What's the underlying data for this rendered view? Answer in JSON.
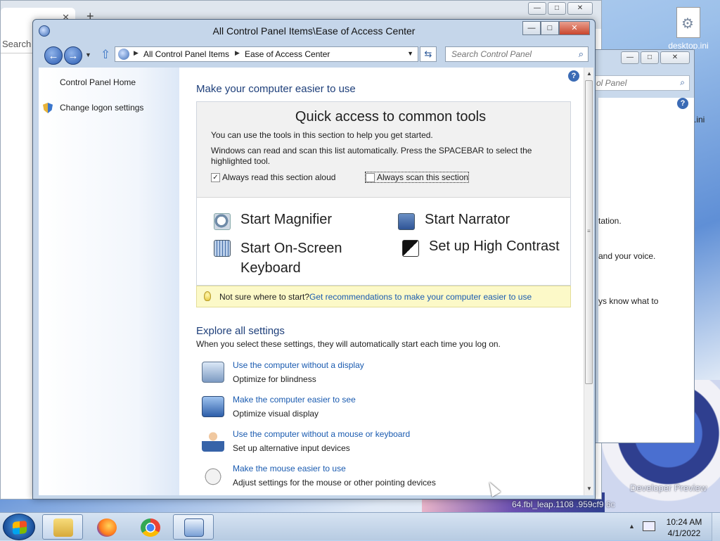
{
  "desktop": {
    "icon_label": "desktop.ini",
    "watermark_line1": "Developer Preview",
    "watermark_line2": "64.fbl_leap.1108 .959cf9 6c"
  },
  "browser_bg": {
    "search_label": "Search"
  },
  "bg_window": {
    "search_placeholder": "ol Panel",
    "text1": "tation.",
    "text2": "and your voice.",
    "text3": "ys know what to",
    "text4": ".ini"
  },
  "window": {
    "title": "All Control Panel Items\\Ease of Access Center",
    "controls": {
      "minimize": "—",
      "maximize": "□",
      "close": "✕"
    }
  },
  "navbar": {
    "breadcrumb": [
      "All Control Panel Items",
      "Ease of Access Center"
    ],
    "search_placeholder": "Search Control Panel"
  },
  "sidebar": {
    "home": "Control Panel Home",
    "logon": "Change logon settings"
  },
  "main": {
    "heading": "Make your computer easier to use",
    "quick_access": {
      "title": "Quick access to common tools",
      "p1": "You can use the tools in this section to help you get started.",
      "p2": "Windows can read and scan this list automatically.  Press the SPACEBAR to select the highlighted tool.",
      "read_aloud": "Always read this section aloud",
      "read_aloud_checked": true,
      "scan": "Always scan this section",
      "scan_checked": false
    },
    "tools": {
      "magnifier": "Start Magnifier",
      "narrator": "Start Narrator",
      "osk": "Start On-Screen Keyboard",
      "contrast": "Set up High Contrast"
    },
    "tip": {
      "prefix": "Not sure where to start?",
      "link": "Get recommendations to make your computer easier to use"
    },
    "explore": {
      "heading": "Explore all settings",
      "subtitle": "When you select these settings, they will automatically start each time you log on.",
      "items": [
        {
          "link": "Use the computer without a display",
          "desc": "Optimize for blindness"
        },
        {
          "link": "Make the computer easier to see",
          "desc": "Optimize visual display"
        },
        {
          "link": "Use the computer without a mouse or keyboard",
          "desc": "Set up alternative input devices"
        },
        {
          "link": "Make the mouse easier to use",
          "desc": "Adjust settings for the mouse or other pointing devices"
        }
      ]
    }
  },
  "taskbar": {
    "time": "10:24 AM",
    "date": "4/1/2022"
  }
}
